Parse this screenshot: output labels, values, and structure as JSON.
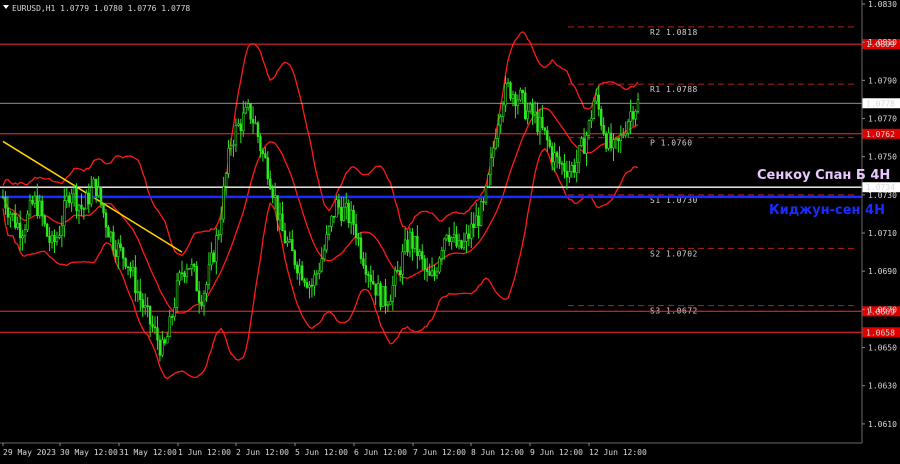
{
  "header": {
    "symbol": "EURUSD,H1",
    "ohlc": "1.0779 1.0780 1.0776 1.0778"
  },
  "colors": {
    "background": "#000000",
    "bull_candle": "#2ee81f",
    "bear_candle": "#2ee81f",
    "bands": "#ff1a1a",
    "level_line": "#ff2a2a",
    "kijun": "#1a2bff",
    "senkou": "#ffffff",
    "trendline": "#ffd400",
    "pivot_dash": "#b02020",
    "price_box": "#ffffff",
    "red_box": "#e00000",
    "kijun_label": "#1a2bff",
    "senkou_label": "#e8c8ff"
  },
  "chart_data": {
    "type": "candlestick",
    "symbol": "EURUSD",
    "timeframe": "H1",
    "ylim": [
      1.06,
      1.083
    ],
    "y_ticks": [
      "1.0830",
      "1.0810",
      "1.0790",
      "1.0770",
      "1.0750",
      "1.0730",
      "1.0710",
      "1.0690",
      "1.0670",
      "1.0650",
      "1.0630",
      "1.0610"
    ],
    "x_ticks": [
      "29 May 2023",
      "30 May 12:00",
      "31 May 12:00",
      "1 Jun 12:00",
      "2 Jun 12:00",
      "5 Jun 12:00",
      "6 Jun 12:00",
      "7 Jun 12:00",
      "8 Jun 12:00",
      "9 Jun 12:00",
      "12 Jun 12:00"
    ],
    "close_path": [
      1.0729,
      1.0722,
      1.0716,
      1.0712,
      1.0718,
      1.0727,
      1.0722,
      1.071,
      1.0703,
      1.071,
      1.0722,
      1.0735,
      1.0727,
      1.0722,
      1.073,
      1.0736,
      1.0724,
      1.0713,
      1.0705,
      1.07,
      1.0697,
      1.0688,
      1.0678,
      1.0669,
      1.0662,
      1.0655,
      1.0647,
      1.066,
      1.0677,
      1.069,
      1.0695,
      1.0688,
      1.0676,
      1.0683,
      1.0697,
      1.0712,
      1.0736,
      1.0758,
      1.0765,
      1.077,
      1.0774,
      1.0766,
      1.0752,
      1.0744,
      1.073,
      1.0713,
      1.0705,
      1.0698,
      1.0693,
      1.0688,
      1.0682,
      1.069,
      1.07,
      1.0712,
      1.0725,
      1.0722,
      1.0719,
      1.0715,
      1.0702,
      1.0693,
      1.0685,
      1.0678,
      1.0675,
      1.068,
      1.0688,
      1.0699,
      1.0707,
      1.0702,
      1.0694,
      1.0685,
      1.0688,
      1.0703,
      1.0713,
      1.0706,
      1.0701,
      1.0705,
      1.0712,
      1.0718,
      1.0723,
      1.0742,
      1.0766,
      1.0781,
      1.0786,
      1.0783,
      1.078,
      1.0773,
      1.0772,
      1.0766,
      1.076,
      1.0752,
      1.0747,
      1.0745,
      1.0743,
      1.0747,
      1.0755,
      1.0765,
      1.0782,
      1.077,
      1.0758,
      1.0753,
      1.0757,
      1.0767,
      1.0775,
      1.0778
    ],
    "levels": [
      {
        "name": "R2",
        "value": 1.0818,
        "label": "R2  1.0818",
        "style": "pivot"
      },
      {
        "name": "red",
        "value": 1.0809,
        "label": "1.0809",
        "style": "red"
      },
      {
        "name": "R1",
        "value": 1.0788,
        "label": "R1  1.0788",
        "style": "pivot"
      },
      {
        "name": "price",
        "value": 1.0778,
        "label": "1.0778",
        "style": "price"
      },
      {
        "name": "red",
        "value": 1.0762,
        "label": "1.0762",
        "style": "red"
      },
      {
        "name": "P",
        "value": 1.076,
        "label": "P  1.0760",
        "style": "pivot"
      },
      {
        "name": "senkou",
        "value": 1.0734,
        "label": "1.0734",
        "style": "senkou"
      },
      {
        "name": "S1",
        "value": 1.073,
        "label": "S1  1.0730",
        "style": "pivot"
      },
      {
        "name": "kijun",
        "value": 1.073,
        "label": "1.0730",
        "style": "kijun"
      },
      {
        "name": "S2",
        "value": 1.0702,
        "label": "S2  1.0702",
        "style": "pivot"
      },
      {
        "name": "S3",
        "value": 1.0672,
        "label": "S3  1.0672",
        "style": "pivot"
      },
      {
        "name": "red",
        "value": 1.0669,
        "label": "1.0669",
        "style": "red"
      },
      {
        "name": "red",
        "value": 1.0658,
        "label": "1.0658",
        "style": "red"
      }
    ],
    "annotations": {
      "senkou_label": "Сенкоу Спан Б 4Н",
      "kijun_label": "Киджун-сен 4Н"
    },
    "trendline": {
      "from": [
        0,
        1.0758
      ],
      "to": [
        0.2,
        1.07
      ]
    }
  }
}
